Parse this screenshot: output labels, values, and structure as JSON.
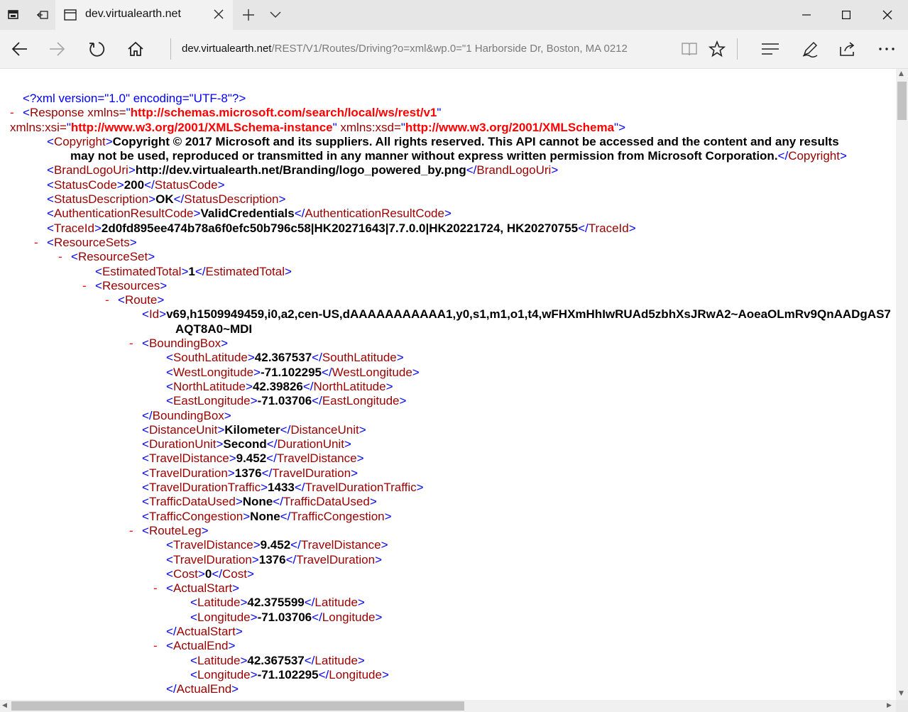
{
  "window": {
    "tab_title": "dev.virtualearth.net"
  },
  "navbar": {
    "address_host": "dev.virtualearth.net",
    "address_path": "/REST/V1/Routes/Driving?o=xml&wp.0=\"1 Harborside Dr, Boston, MA 0212"
  },
  "icons": {
    "tab_actions": "tab-set-aside-icon",
    "back": "back-arrow-icon",
    "forward": "forward-arrow-icon",
    "refresh": "refresh-icon",
    "home": "home-icon",
    "reading_view": "reading-view-icon",
    "favorite": "star-icon",
    "hub": "hub-icon",
    "notes": "pen-icon",
    "share": "share-icon",
    "more": "more-icon"
  },
  "colors": {
    "tag_bracket": "#0000ff",
    "tag_name": "#990000",
    "attr_value": "#ff0000",
    "text_value": "#000000",
    "toggle": "#ff0000"
  },
  "xml": {
    "declaration": "<?xml version=\"1.0\" encoding=\"UTF-8\"?>",
    "toggle": "-",
    "response_tag": "Response",
    "attr_xmlns": "xmlns=",
    "xmlns_val": "http://schemas.microsoft.com/search/local/ws/rest/v1",
    "attr_xmlns_xsi": "xmlns:xsi=",
    "xmlns_xsi_val": "http://www.w3.org/2001/XMLSchema-instance",
    "attr_xmlns_xsd": "xmlns:xsd=",
    "xmlns_xsd_val": "http://www.w3.org/2001/XMLSchema",
    "copyright": "Copyright © 2017 Microsoft and its suppliers. All rights reserved. This API cannot be accessed and the content and any results may not be used, reproduced or transmitted in any manner without express written permission from Microsoft Corporation.",
    "brand_logo_uri": "http://dev.virtualearth.net/Branding/logo_powered_by.png",
    "status_code": "200",
    "status_description": "OK",
    "auth_result_code": "ValidCredentials",
    "trace_id": "2d0fd895ee474b78a6f0efc50b796c58|HK20271643|7.7.0.0|HK20221724, HK20270755",
    "estimated_total": "1",
    "route_id": "v69,h1509949459,i0,a2,cen-US,dAAAAAAAAAAA1,y0,s1,m1,o1,t4,wFHXmHhIwRUAd5zbhXsJRwA2~AoeaOLmRv9QnAADgAS7AQT8A0~MDI",
    "south_latitude": "42.367537",
    "west_longitude": "-71.102295",
    "north_latitude": "42.39826",
    "east_longitude": "-71.03706",
    "distance_unit": "Kilometer",
    "duration_unit": "Second",
    "travel_distance": "9.452",
    "travel_duration": "1376",
    "travel_duration_traffic": "1433",
    "traffic_data_used": "None",
    "traffic_congestion": "None",
    "leg_travel_distance": "9.452",
    "leg_travel_duration": "1376",
    "leg_cost": "0",
    "start_latitude": "42.375599",
    "start_longitude": "-71.03706",
    "end_latitude": "42.367537",
    "end_longitude": "-71.102295",
    "tags": {
      "copyright": "Copyright",
      "brand_logo_uri": "BrandLogoUri",
      "status_code": "StatusCode",
      "status_description": "StatusDescription",
      "auth_result_code": "AuthenticationResultCode",
      "trace_id": "TraceId",
      "resource_sets": "ResourceSets",
      "resource_set": "ResourceSet",
      "estimated_total": "EstimatedTotal",
      "resources": "Resources",
      "route": "Route",
      "id": "Id",
      "bounding_box": "BoundingBox",
      "south_latitude": "SouthLatitude",
      "west_longitude": "WestLongitude",
      "north_latitude": "NorthLatitude",
      "east_longitude": "EastLongitude",
      "distance_unit": "DistanceUnit",
      "duration_unit": "DurationUnit",
      "travel_distance": "TravelDistance",
      "travel_duration": "TravelDuration",
      "travel_duration_traffic": "TravelDurationTraffic",
      "traffic_data_used": "TrafficDataUsed",
      "traffic_congestion": "TrafficCongestion",
      "route_leg": "RouteLeg",
      "cost": "Cost",
      "actual_start": "ActualStart",
      "actual_end": "ActualEnd",
      "latitude": "Latitude",
      "longitude": "Longitude"
    }
  }
}
